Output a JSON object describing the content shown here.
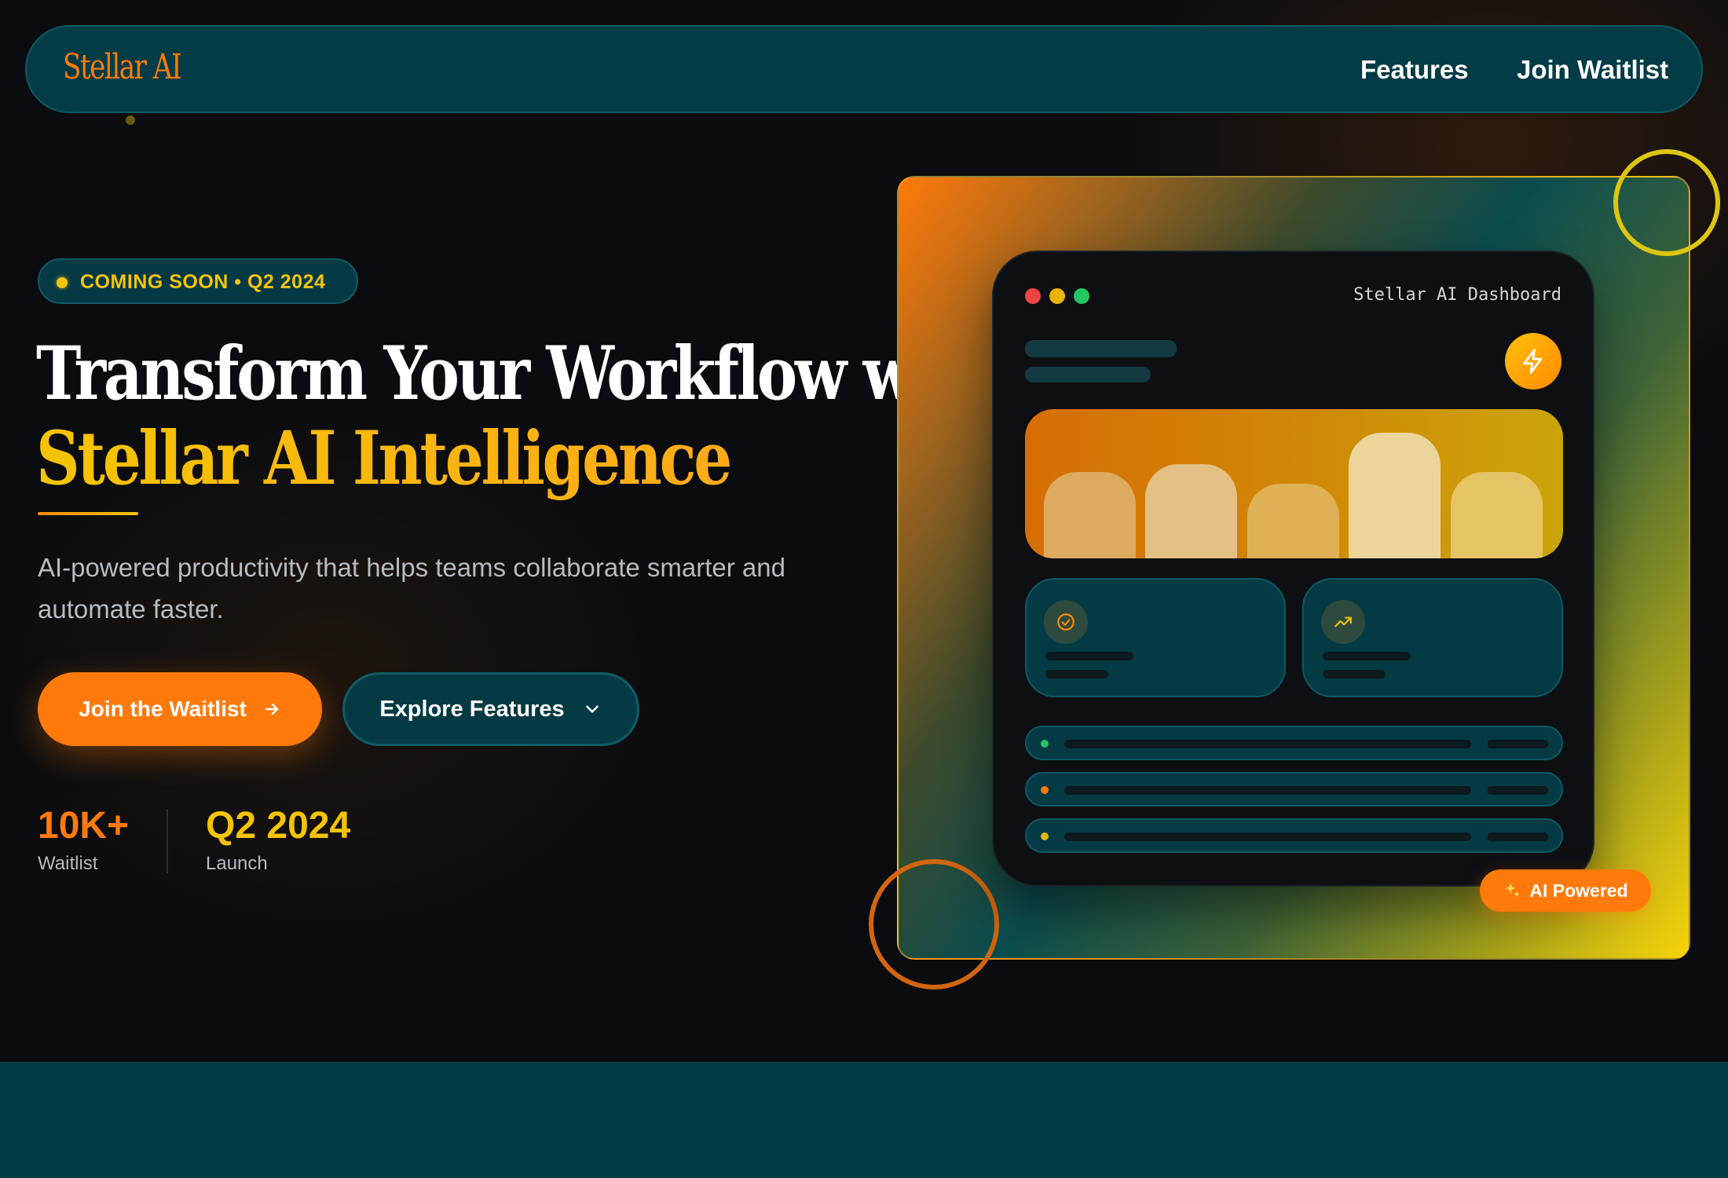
{
  "nav": {
    "logo": "Stellar AI",
    "links": [
      {
        "label": "Features"
      },
      {
        "label": "Join Waitlist"
      }
    ]
  },
  "hero": {
    "badge": "COMING SOON • Q2 2024",
    "headline_line1": "Transform Your Workflow with",
    "headline_line2": "Stellar AI Intelligence",
    "subtext": "AI-powered productivity that helps teams collaborate smarter and automate faster.",
    "primary_button": {
      "label": "Join the Waitlist",
      "icon": "arrow-right-icon"
    },
    "secondary_button": {
      "label": "Explore Features",
      "icon": "chevron-down-icon"
    },
    "stats": [
      {
        "value": "10K+",
        "label": "Waitlist"
      },
      {
        "value": "Q2 2024",
        "label": "Launch"
      }
    ]
  },
  "dashboard": {
    "title": "Stellar AI Dashboard",
    "window_controls": [
      "red",
      "yellow",
      "green"
    ],
    "header_icon": "lightning-bolt-icon",
    "bars": [
      0.58,
      0.63,
      0.5,
      0.84,
      0.58
    ],
    "cards": [
      {
        "icon": "check-circle-icon"
      },
      {
        "icon": "trending-up-icon"
      }
    ],
    "list_status_colors": [
      "#22c55e",
      "#ff7a0a",
      "#eab308"
    ]
  },
  "ai_badge": {
    "label": "AI Powered",
    "icon": "sparkles-icon"
  },
  "colors": {
    "accent_orange": "#ff7a0a",
    "accent_yellow": "#f5c400",
    "teal": "#023c46",
    "background": "#0b0c0f"
  }
}
